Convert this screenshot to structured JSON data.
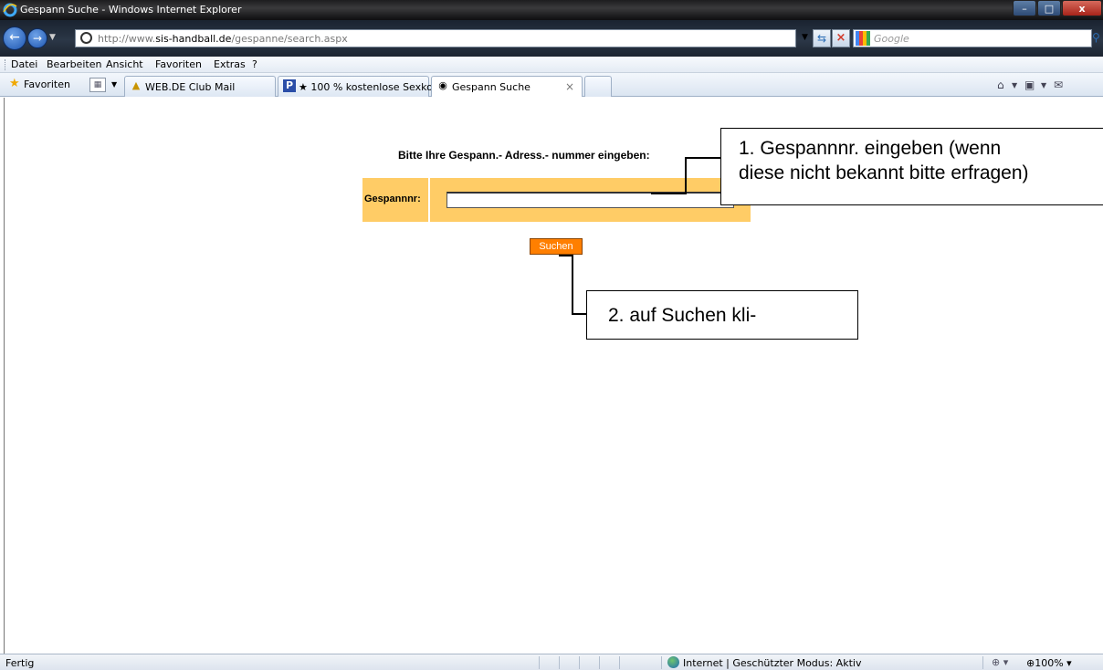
{
  "window": {
    "title": "Gespann Suche - Windows Internet Explorer",
    "controls": {
      "minimize": "–",
      "maximize": "□",
      "close": "x"
    }
  },
  "address_bar": {
    "url_prefix": "http://www.",
    "url_domain": "sis-handball.de",
    "url_path": "/gespanne/search.aspx",
    "search_placeholder": "Google"
  },
  "menu": {
    "items": [
      {
        "label": "Datei"
      },
      {
        "label": "Bearbeiten"
      },
      {
        "label": "Ansicht"
      },
      {
        "label": "Favoriten"
      },
      {
        "label": "Extras"
      },
      {
        "label": "?"
      }
    ]
  },
  "favorites_bar": {
    "favorites_label": "Favoriten",
    "tabs": [
      {
        "label": "WEB.DE Club Mail",
        "icon": "webde-icon"
      },
      {
        "label": "★ 100 % kostenlose Sexko...",
        "icon": "p-icon"
      },
      {
        "label": "Gespann Suche",
        "icon": "page-icon",
        "active": true
      }
    ]
  },
  "page": {
    "prompt": "Bitte Ihre Gespann.- Adress.- nummer eingeben:",
    "field_label": "Gespannnr:",
    "field_value": "",
    "search_button": "Suchen"
  },
  "callouts": {
    "step1_line1": "1. Gespannnr. eingeben (wenn",
    "step1_line2": "diese nicht bekannt bitte erfragen)",
    "step2": "2. auf Suchen kli-"
  },
  "status_bar": {
    "status": "Fertig",
    "zone": "Internet | Geschützter Modus: Aktiv",
    "zoom": "100%"
  },
  "colors": {
    "form_background": "#ffcc66",
    "search_button": "#ff7f00"
  }
}
